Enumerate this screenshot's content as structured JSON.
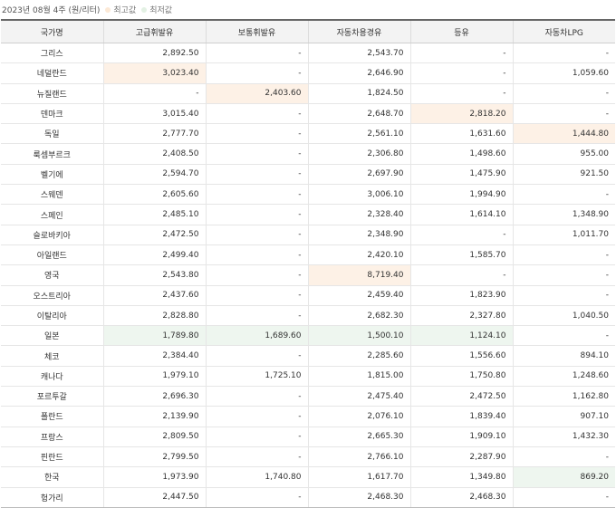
{
  "caption": {
    "period": "2023년 08월 4주 (원/리터)",
    "legend_high_label": "최고값",
    "legend_low_label": "최저값",
    "high_color": "#fce9d6",
    "low_color": "#e3f1e4"
  },
  "columns": [
    "국가명",
    "고급휘발유",
    "보통휘발유",
    "자동차용경유",
    "등유",
    "자동차LPG"
  ],
  "rows": [
    {
      "cells": [
        "그리스",
        "2,892.50",
        "-",
        "2,543.70",
        "-",
        "-"
      ],
      "marks": [
        "",
        "",
        "",
        "",
        "",
        ""
      ]
    },
    {
      "cells": [
        "네덜란드",
        "3,023.40",
        "-",
        "2,646.90",
        "-",
        "1,059.60"
      ],
      "marks": [
        "",
        "hi",
        "",
        "",
        "",
        ""
      ]
    },
    {
      "cells": [
        "뉴질랜드",
        "-",
        "2,403.60",
        "1,824.50",
        "-",
        "-"
      ],
      "marks": [
        "",
        "",
        "hi",
        "",
        "",
        ""
      ]
    },
    {
      "cells": [
        "덴마크",
        "3,015.40",
        "-",
        "2,648.70",
        "2,818.20",
        "-"
      ],
      "marks": [
        "",
        "",
        "",
        "",
        "hi",
        ""
      ]
    },
    {
      "cells": [
        "독일",
        "2,777.70",
        "-",
        "2,561.10",
        "1,631.60",
        "1,444.80"
      ],
      "marks": [
        "",
        "",
        "",
        "",
        "",
        "hi"
      ]
    },
    {
      "cells": [
        "룩셈부르크",
        "2,408.50",
        "-",
        "2,306.80",
        "1,498.60",
        "955.00"
      ],
      "marks": [
        "",
        "",
        "",
        "",
        "",
        ""
      ]
    },
    {
      "cells": [
        "벨기에",
        "2,594.70",
        "-",
        "2,697.90",
        "1,475.90",
        "921.50"
      ],
      "marks": [
        "",
        "",
        "",
        "",
        "",
        ""
      ]
    },
    {
      "cells": [
        "스웨덴",
        "2,605.60",
        "-",
        "3,006.10",
        "1,994.90",
        "-"
      ],
      "marks": [
        "",
        "",
        "",
        "",
        "",
        ""
      ]
    },
    {
      "cells": [
        "스페인",
        "2,485.10",
        "-",
        "2,328.40",
        "1,614.10",
        "1,348.90"
      ],
      "marks": [
        "",
        "",
        "",
        "",
        "",
        ""
      ]
    },
    {
      "cells": [
        "슬로바키아",
        "2,472.50",
        "-",
        "2,348.90",
        "-",
        "1,011.70"
      ],
      "marks": [
        "",
        "",
        "",
        "",
        "",
        ""
      ]
    },
    {
      "cells": [
        "아일랜드",
        "2,499.40",
        "-",
        "2,420.10",
        "1,585.70",
        "-"
      ],
      "marks": [
        "",
        "",
        "",
        "",
        "",
        ""
      ]
    },
    {
      "cells": [
        "영국",
        "2,543.80",
        "-",
        "8,719.40",
        "-",
        "-"
      ],
      "marks": [
        "",
        "",
        "",
        "hi",
        "",
        ""
      ]
    },
    {
      "cells": [
        "오스트리아",
        "2,437.60",
        "-",
        "2,459.40",
        "1,823.90",
        "-"
      ],
      "marks": [
        "",
        "",
        "",
        "",
        "",
        ""
      ]
    },
    {
      "cells": [
        "이탈리아",
        "2,828.80",
        "-",
        "2,682.30",
        "2,327.80",
        "1,040.50"
      ],
      "marks": [
        "",
        "",
        "",
        "",
        "",
        ""
      ]
    },
    {
      "cells": [
        "일본",
        "1,789.80",
        "1,689.60",
        "1,500.10",
        "1,124.10",
        "-"
      ],
      "marks": [
        "",
        "lo",
        "lo",
        "lo",
        "lo",
        ""
      ]
    },
    {
      "cells": [
        "체코",
        "2,384.40",
        "-",
        "2,285.60",
        "1,556.60",
        "894.10"
      ],
      "marks": [
        "",
        "",
        "",
        "",
        "",
        ""
      ]
    },
    {
      "cells": [
        "캐나다",
        "1,979.10",
        "1,725.10",
        "1,815.00",
        "1,750.80",
        "1,248.60"
      ],
      "marks": [
        "",
        "",
        "",
        "",
        "",
        ""
      ]
    },
    {
      "cells": [
        "포르투갈",
        "2,696.30",
        "-",
        "2,475.40",
        "2,472.50",
        "1,162.80"
      ],
      "marks": [
        "",
        "",
        "",
        "",
        "",
        ""
      ]
    },
    {
      "cells": [
        "폴란드",
        "2,139.90",
        "-",
        "2,076.10",
        "1,839.40",
        "907.10"
      ],
      "marks": [
        "",
        "",
        "",
        "",
        "",
        ""
      ]
    },
    {
      "cells": [
        "프랑스",
        "2,809.50",
        "-",
        "2,665.30",
        "1,909.10",
        "1,432.30"
      ],
      "marks": [
        "",
        "",
        "",
        "",
        "",
        ""
      ]
    },
    {
      "cells": [
        "핀란드",
        "2,799.50",
        "-",
        "2,766.10",
        "2,287.90",
        "-"
      ],
      "marks": [
        "",
        "",
        "",
        "",
        "",
        ""
      ]
    },
    {
      "cells": [
        "한국",
        "1,973.90",
        "1,740.80",
        "1,617.70",
        "1,349.80",
        "869.20"
      ],
      "marks": [
        "",
        "",
        "",
        "",
        "",
        "lo"
      ]
    },
    {
      "cells": [
        "헝가리",
        "2,447.50",
        "-",
        "2,468.30",
        "2,468.30",
        "-"
      ],
      "marks": [
        "",
        "",
        "",
        "",
        "",
        ""
      ]
    }
  ]
}
